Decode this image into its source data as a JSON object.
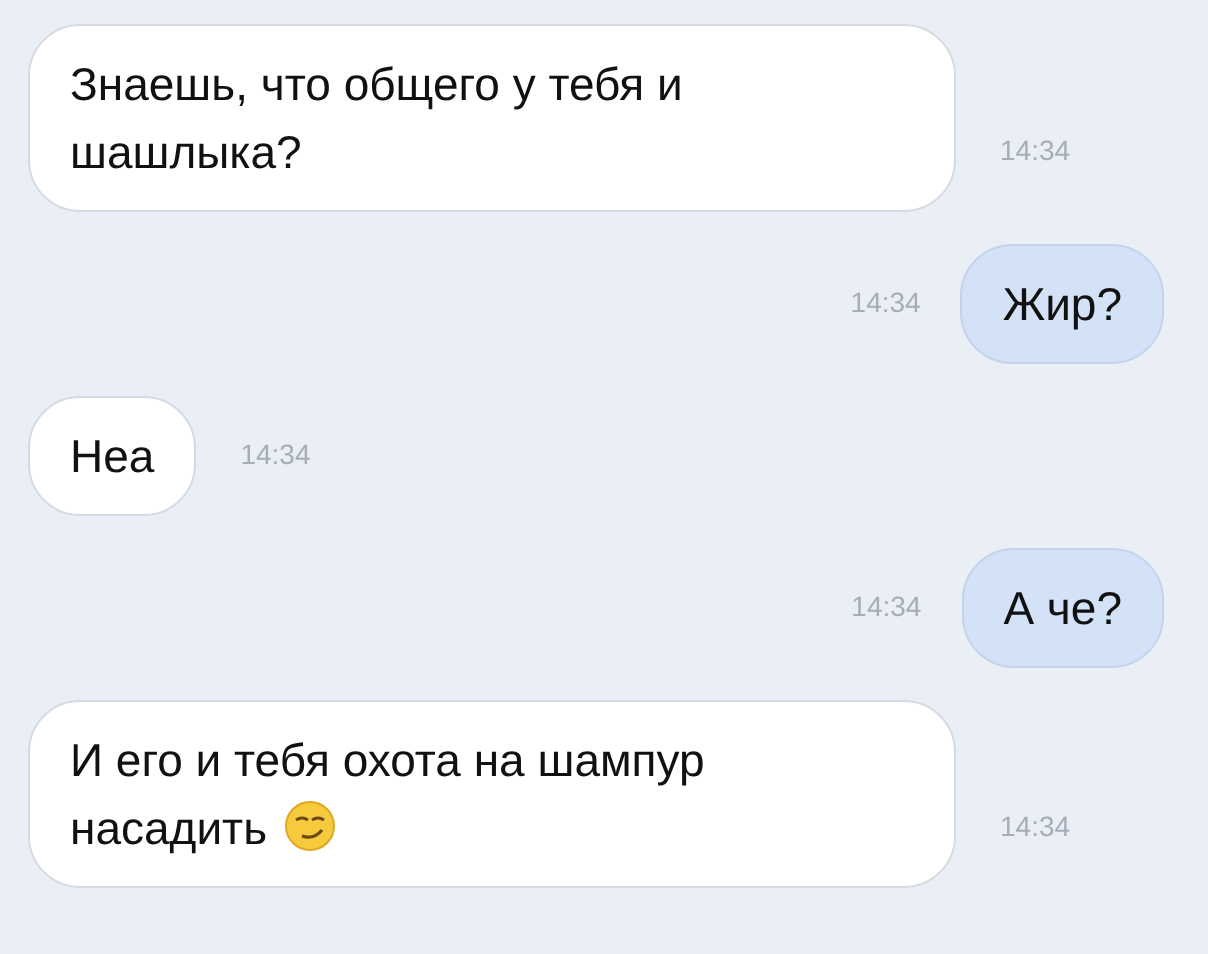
{
  "messages": [
    {
      "kind": "received",
      "text": "Знаешь, что общего у тебя и шашлыка?",
      "time": "14:34",
      "emoji": false
    },
    {
      "kind": "sent",
      "text": "Жир?",
      "time": "14:34",
      "emoji": false
    },
    {
      "kind": "received",
      "text": "Неа",
      "time": "14:34",
      "emoji": false
    },
    {
      "kind": "sent",
      "text": "А че?",
      "time": "14:34",
      "emoji": false
    },
    {
      "kind": "received",
      "text": "И его и тебя охота на шампур насадить",
      "time": "14:34",
      "emoji": true
    }
  ]
}
